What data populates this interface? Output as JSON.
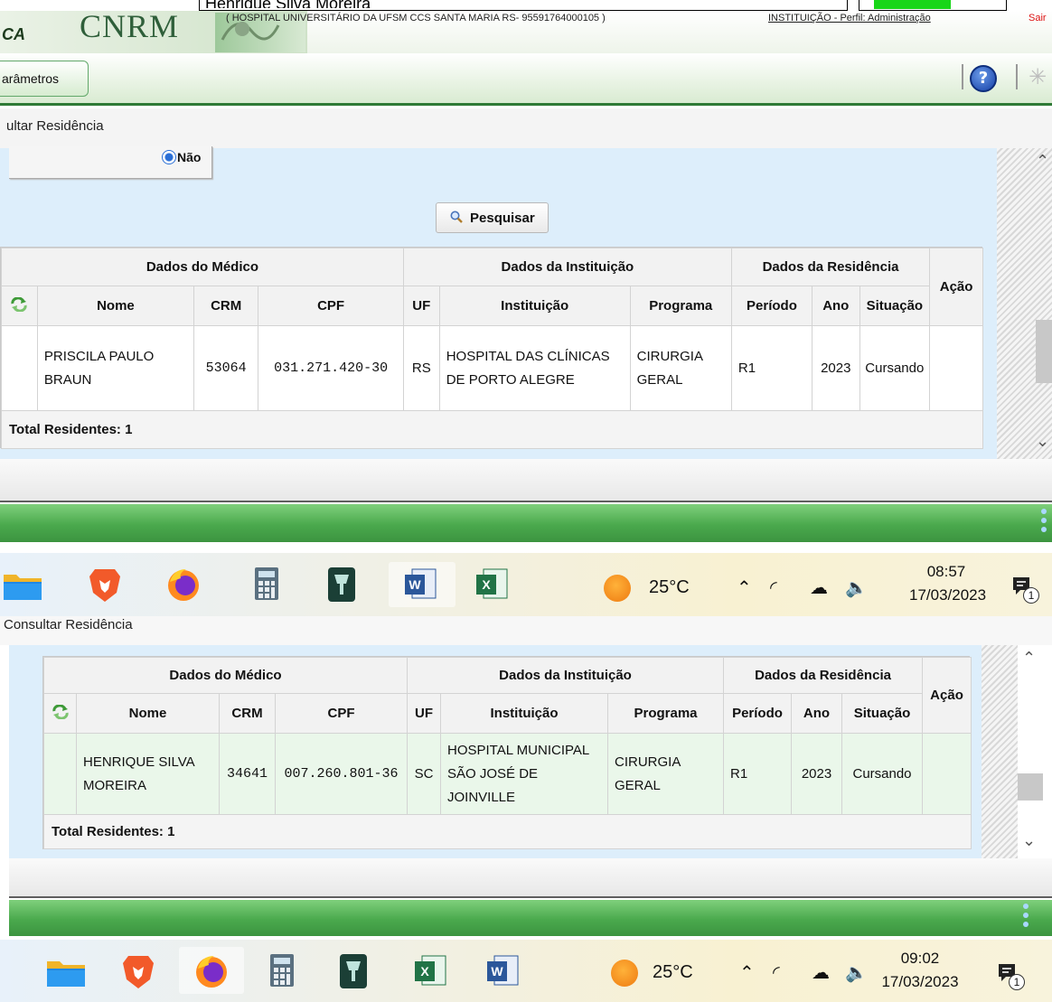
{
  "top": {
    "user_name": "Henrique Silva Moreira"
  },
  "header": {
    "logo_left": "CA",
    "logo": "CNRM",
    "institution": "( HOSPITAL UNIVERSITÁRIO DA UFSM CCS SANTA MARIA RS- 95591764000105 )",
    "profile": "INSTITUIÇÃO - Perfil: Administração",
    "exit": "Sair"
  },
  "menu": {
    "tab_label": "arâmetros",
    "help": "?"
  },
  "screen1": {
    "breadcrumb": "ultar Residência",
    "radio_label": "Não",
    "search_button": "Pesquisar",
    "table": {
      "group_headers": [
        "Dados do Médico",
        "Dados da Instituição",
        "Dados da Residência",
        "Ação"
      ],
      "col_headers": [
        "Nome",
        "CRM",
        "CPF",
        "UF",
        "Instituição",
        "Programa",
        "Período",
        "Ano",
        "Situação"
      ],
      "row": {
        "nome": "PRISCILA PAULO BRAUN",
        "crm": "53064",
        "cpf": "031.271.420-30",
        "uf": "RS",
        "instituicao": "HOSPITAL DAS CLÍNICAS DE PORTO ALEGRE",
        "programa": "CIRURGIA GERAL",
        "periodo": "R1",
        "ano": "2023",
        "situacao": "Cursando"
      },
      "total": "Total Residentes: 1"
    },
    "taskbar": {
      "temperature": "25°C",
      "time": "08:57",
      "date": "17/03/2023",
      "notifications": "1"
    }
  },
  "screen2": {
    "breadcrumb": "Consultar Residência",
    "table": {
      "group_headers": [
        "Dados do Médico",
        "Dados da Instituição",
        "Dados da Residência",
        "Ação"
      ],
      "col_headers": [
        "Nome",
        "CRM",
        "CPF",
        "UF",
        "Instituição",
        "Programa",
        "Período",
        "Ano",
        "Situação"
      ],
      "row": {
        "nome": "HENRIQUE SILVA MOREIRA",
        "crm": "34641",
        "cpf": "007.260.801-36",
        "uf": "SC",
        "instituicao": "HOSPITAL MUNICIPAL SÃO JOSÉ DE JOINVILLE",
        "programa": "CIRURGIA GERAL",
        "periodo": "R1",
        "ano": "2023",
        "situacao": "Cursando"
      },
      "total": "Total Residentes: 1"
    },
    "taskbar": {
      "temperature": "25°C",
      "time": "09:02",
      "date": "17/03/2023",
      "notifications": "1"
    }
  },
  "taskbar_icons": [
    "folder-icon",
    "brave-icon",
    "firefox-icon",
    "calculator-icon",
    "remote-access-icon",
    "word-icon",
    "excel-icon"
  ],
  "colors": {
    "accent_green": "#4aa94d",
    "panel_blue": "#ddeefb",
    "row_highlight": "#eaf7ea",
    "sun": "#ee7a10"
  }
}
